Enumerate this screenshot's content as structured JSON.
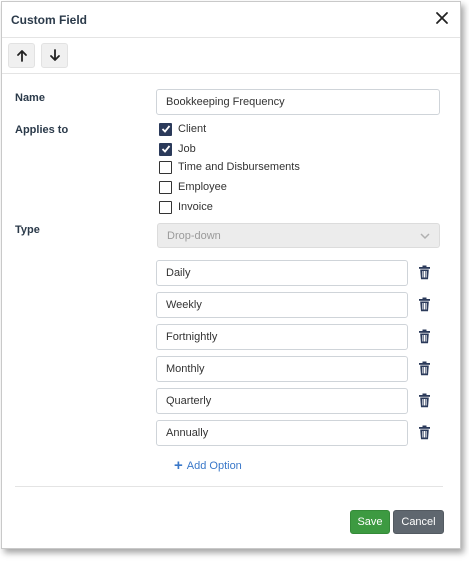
{
  "dialog": {
    "title": "Custom Field"
  },
  "toolbar": {
    "up_icon": "arrow-up-icon",
    "down_icon": "arrow-down-icon"
  },
  "form": {
    "name_label": "Name",
    "name_value": "Bookkeeping Frequency",
    "applies_label": "Applies to",
    "applies_options": [
      {
        "label": "Client",
        "checked": true
      },
      {
        "label": "Job",
        "checked": true
      },
      {
        "label": "Time and Disbursements",
        "checked": false
      },
      {
        "label": "Employee",
        "checked": false
      },
      {
        "label": "Invoice",
        "checked": false
      }
    ],
    "type_label": "Type",
    "type_value": "Drop-down",
    "options": [
      "Daily",
      "Weekly",
      "Fortnightly",
      "Monthly",
      "Quarterly",
      "Annually"
    ],
    "add_option_label": "Add Option"
  },
  "footer": {
    "save_label": "Save",
    "cancel_label": "Cancel"
  },
  "colors": {
    "accent_blue": "#3a78c9",
    "save_green": "#3d9a41",
    "cancel_gray": "#5f676f",
    "checkbox_navy": "#2b3a5a"
  }
}
